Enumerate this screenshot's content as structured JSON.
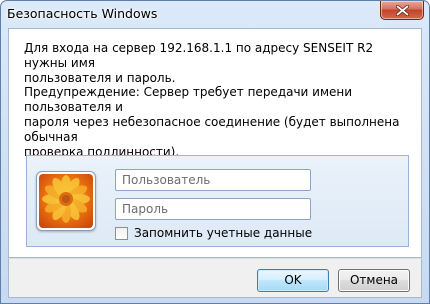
{
  "window": {
    "title": "Безопасность Windows"
  },
  "message": {
    "prompt": "Для входа на сервер 192.168.1.1 по адресу SENSEIT R2 нужны имя\nпользователя и пароль.",
    "warning": "Предупреждение: Сервер требует передачи имени пользователя и\nпароля через небезопасное соединение (будет выполнена обычная\nпроверка подлинности)."
  },
  "credentials": {
    "username_value": "",
    "username_placeholder": "Пользователь",
    "password_value": "",
    "password_placeholder": "Пароль",
    "remember_label": "Запомнить учетные данные",
    "remember_checked": false
  },
  "buttons": {
    "ok_label": "OK",
    "cancel_label": "Отмена"
  },
  "icons": {
    "close": "close-icon",
    "avatar": "user-tile-flower"
  }
}
